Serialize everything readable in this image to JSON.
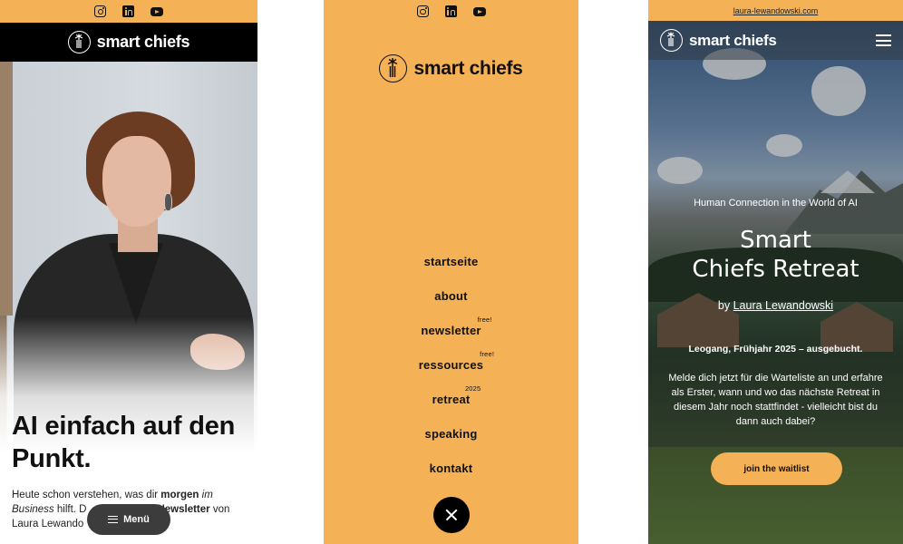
{
  "social": {
    "icons": [
      "instagram-icon",
      "linkedin-icon",
      "youtube-icon"
    ]
  },
  "brand": {
    "name": "smart chiefs",
    "accent": "#f5b155"
  },
  "screen1": {
    "headline": "AI einfach auf den Punkt.",
    "intro": {
      "part1": "Heute schon verstehen, was dir ",
      "bold1": "morgen",
      "italic1": "im Business",
      "part2": " hilft. D",
      "bold2": "Newsletter",
      "part3": " von Laura Lewando"
    },
    "menu_button": "Menü"
  },
  "screen2": {
    "nav": [
      {
        "label": "startseite",
        "sup": ""
      },
      {
        "label": "about",
        "sup": ""
      },
      {
        "label": "newsletter",
        "sup": "free!"
      },
      {
        "label": "ressources",
        "sup": "free!"
      },
      {
        "label": "retreat",
        "sup": "2025"
      },
      {
        "label": "speaking",
        "sup": ""
      },
      {
        "label": "kontakt",
        "sup": ""
      }
    ]
  },
  "screen3": {
    "site_link": "laura-lewandowski.com",
    "kicker": "Human Connection in the World of AI",
    "title_line1": "Smart",
    "title_line2": "Chiefs Retreat",
    "by_prefix": "by ",
    "by_name": "Laura Lewandowski",
    "location": "Leogang, Frühjahr 2025 – ausgebucht.",
    "description": "Melde dich jetzt für die Warteliste an und erfahre als Erster, wann und wo das nächste Retreat in diesem Jahr noch stattfindet - vielleicht bist du dann auch dabei?",
    "cta": "join the waitlist"
  }
}
